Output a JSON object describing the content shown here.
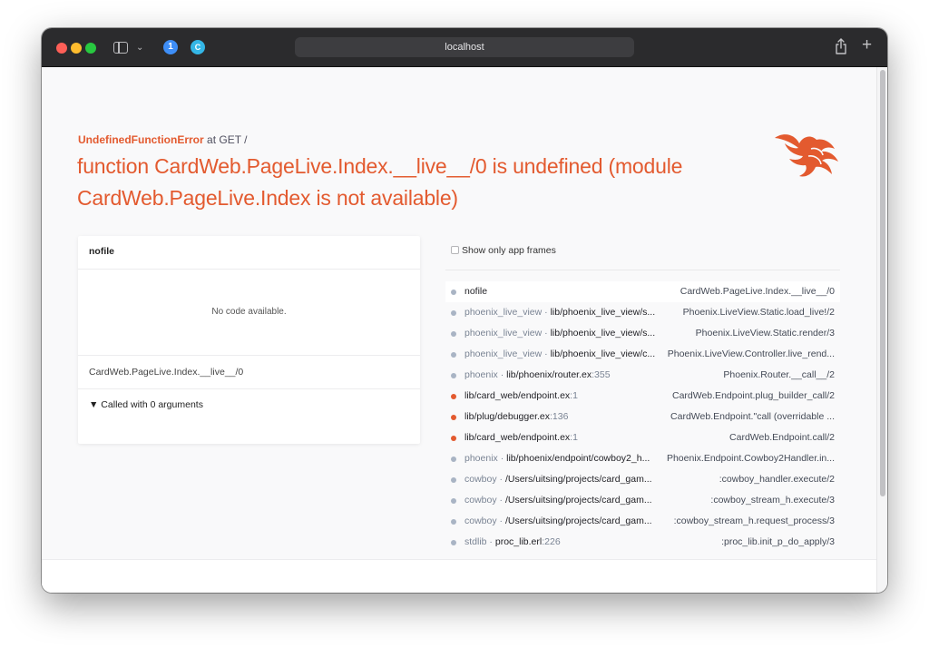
{
  "browser": {
    "url": "localhost"
  },
  "error": {
    "kind": "UndefinedFunctionError",
    "where": "at GET /",
    "message": "function CardWeb.PageLive.Index.__live__/0 is undefined (module CardWeb.PageLive.Index is not available)"
  },
  "code_panel": {
    "title": "nofile",
    "no_code": "No code available.",
    "function": "CardWeb.PageLive.Index.__live__/0",
    "called_with": "▼ Called with 0 arguments"
  },
  "filter": {
    "label": "Show only app frames",
    "checked": false
  },
  "frames": [
    {
      "app": "",
      "file": "nofile",
      "line": "",
      "fn": "CardWeb.PageLive.Index.__live__/0",
      "is_app": false,
      "active": true
    },
    {
      "app": "phoenix_live_view",
      "file": "lib/phoenix_live_view/s...",
      "line": "",
      "fn": "Phoenix.LiveView.Static.load_live!/2",
      "is_app": false,
      "active": false
    },
    {
      "app": "phoenix_live_view",
      "file": "lib/phoenix_live_view/s...",
      "line": "",
      "fn": "Phoenix.LiveView.Static.render/3",
      "is_app": false,
      "active": false
    },
    {
      "app": "phoenix_live_view",
      "file": "lib/phoenix_live_view/c...",
      "line": "",
      "fn": "Phoenix.LiveView.Controller.live_rend...",
      "is_app": false,
      "active": false
    },
    {
      "app": "phoenix",
      "file": "lib/phoenix/router.ex",
      "line": ":355",
      "fn": "Phoenix.Router.__call__/2",
      "is_app": false,
      "active": false
    },
    {
      "app": "",
      "file": "lib/card_web/endpoint.ex",
      "line": ":1",
      "fn": "CardWeb.Endpoint.plug_builder_call/2",
      "is_app": true,
      "active": false
    },
    {
      "app": "",
      "file": "lib/plug/debugger.ex",
      "line": ":136",
      "fn": "CardWeb.Endpoint.\"call (overridable ...",
      "is_app": true,
      "active": false
    },
    {
      "app": "",
      "file": "lib/card_web/endpoint.ex",
      "line": ":1",
      "fn": "CardWeb.Endpoint.call/2",
      "is_app": true,
      "active": false
    },
    {
      "app": "phoenix",
      "file": "lib/phoenix/endpoint/cowboy2_h...",
      "line": "",
      "fn": "Phoenix.Endpoint.Cowboy2Handler.in...",
      "is_app": false,
      "active": false
    },
    {
      "app": "cowboy",
      "file": "/Users/uitsing/projects/card_gam...",
      "line": "",
      "fn": ":cowboy_handler.execute/2",
      "is_app": false,
      "active": false
    },
    {
      "app": "cowboy",
      "file": "/Users/uitsing/projects/card_gam...",
      "line": "",
      "fn": ":cowboy_stream_h.execute/3",
      "is_app": false,
      "active": false
    },
    {
      "app": "cowboy",
      "file": "/Users/uitsing/projects/card_gam...",
      "line": "",
      "fn": ":cowboy_stream_h.request_process/3",
      "is_app": false,
      "active": false
    },
    {
      "app": "stdlib",
      "file": "proc_lib.erl",
      "line": ":226",
      "fn": ":proc_lib.init_p_do_apply/3",
      "is_app": false,
      "active": false
    }
  ],
  "colors": {
    "accent": "#e35a2f",
    "app_frame_dot": "#e35a2f",
    "dep_frame_dot": "#a9b4c4"
  }
}
